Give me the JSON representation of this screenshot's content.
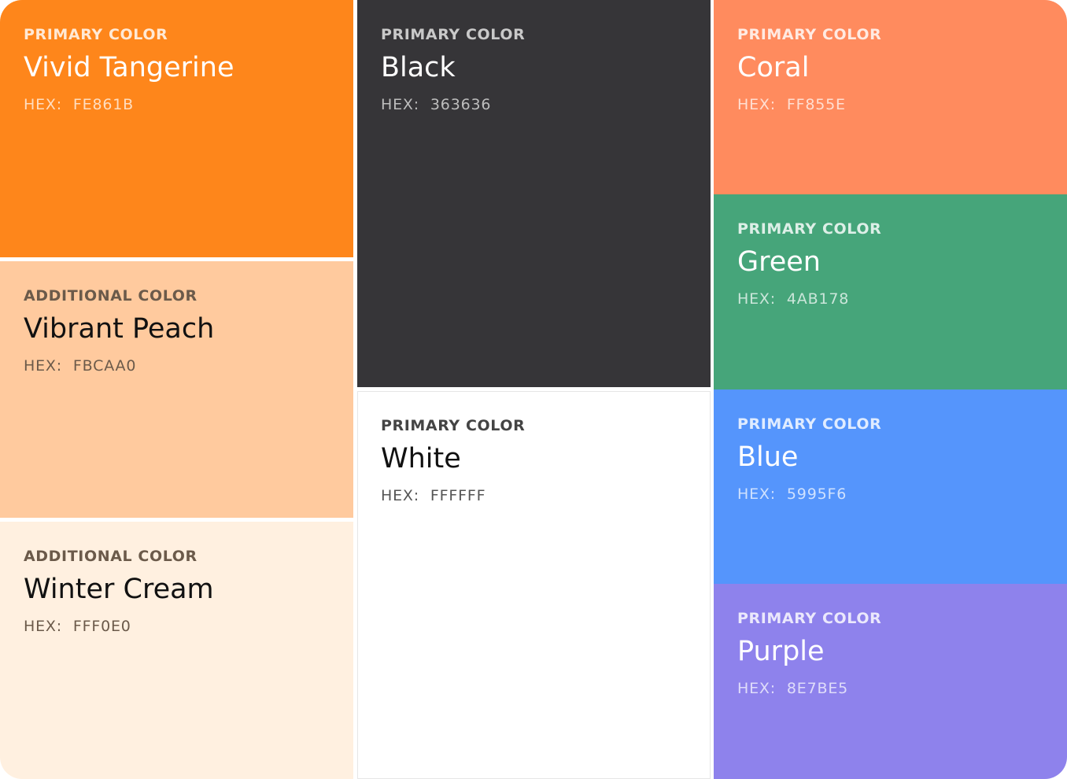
{
  "swatches": {
    "tangerine": {
      "label": "PRIMARY COLOR",
      "name": "Vivid Tangerine",
      "hex_label": "HEX:",
      "hex": "FE861B",
      "color": "#FE861B"
    },
    "peach": {
      "label": "ADDITIONAL COLOR",
      "name": "Vibrant Peach",
      "hex_label": "HEX:",
      "hex": "FBCAA0",
      "color": "#FFCA9E"
    },
    "cream": {
      "label": "ADDITIONAL COLOR",
      "name": "Winter Cream",
      "hex_label": "HEX:",
      "hex": "FFF0E0",
      "color": "#FFF0E0"
    },
    "black": {
      "label": "PRIMARY COLOR",
      "name": "Black",
      "hex_label": "HEX:",
      "hex": "363636",
      "color": "#363538"
    },
    "white": {
      "label": "PRIMARY COLOR",
      "name": "White",
      "hex_label": "HEX:",
      "hex": "FFFFFF",
      "color": "#FFFFFF"
    },
    "coral": {
      "label": "PRIMARY COLOR",
      "name": "Coral",
      "hex_label": "HEX:",
      "hex": "FF855E",
      "color": "#FF8B5E"
    },
    "green": {
      "label": "PRIMARY COLOR",
      "name": "Green",
      "hex_label": "HEX:",
      "hex": "4AB178",
      "color": "#46A57A"
    },
    "blue": {
      "label": "PRIMARY COLOR",
      "name": "Blue",
      "hex_label": "HEX:",
      "hex": "5995F6",
      "color": "#5595FC"
    },
    "purple": {
      "label": "PRIMARY COLOR",
      "name": "Purple",
      "hex_label": "HEX:",
      "hex": "8E7BE5",
      "color": "#8E82EC"
    }
  }
}
